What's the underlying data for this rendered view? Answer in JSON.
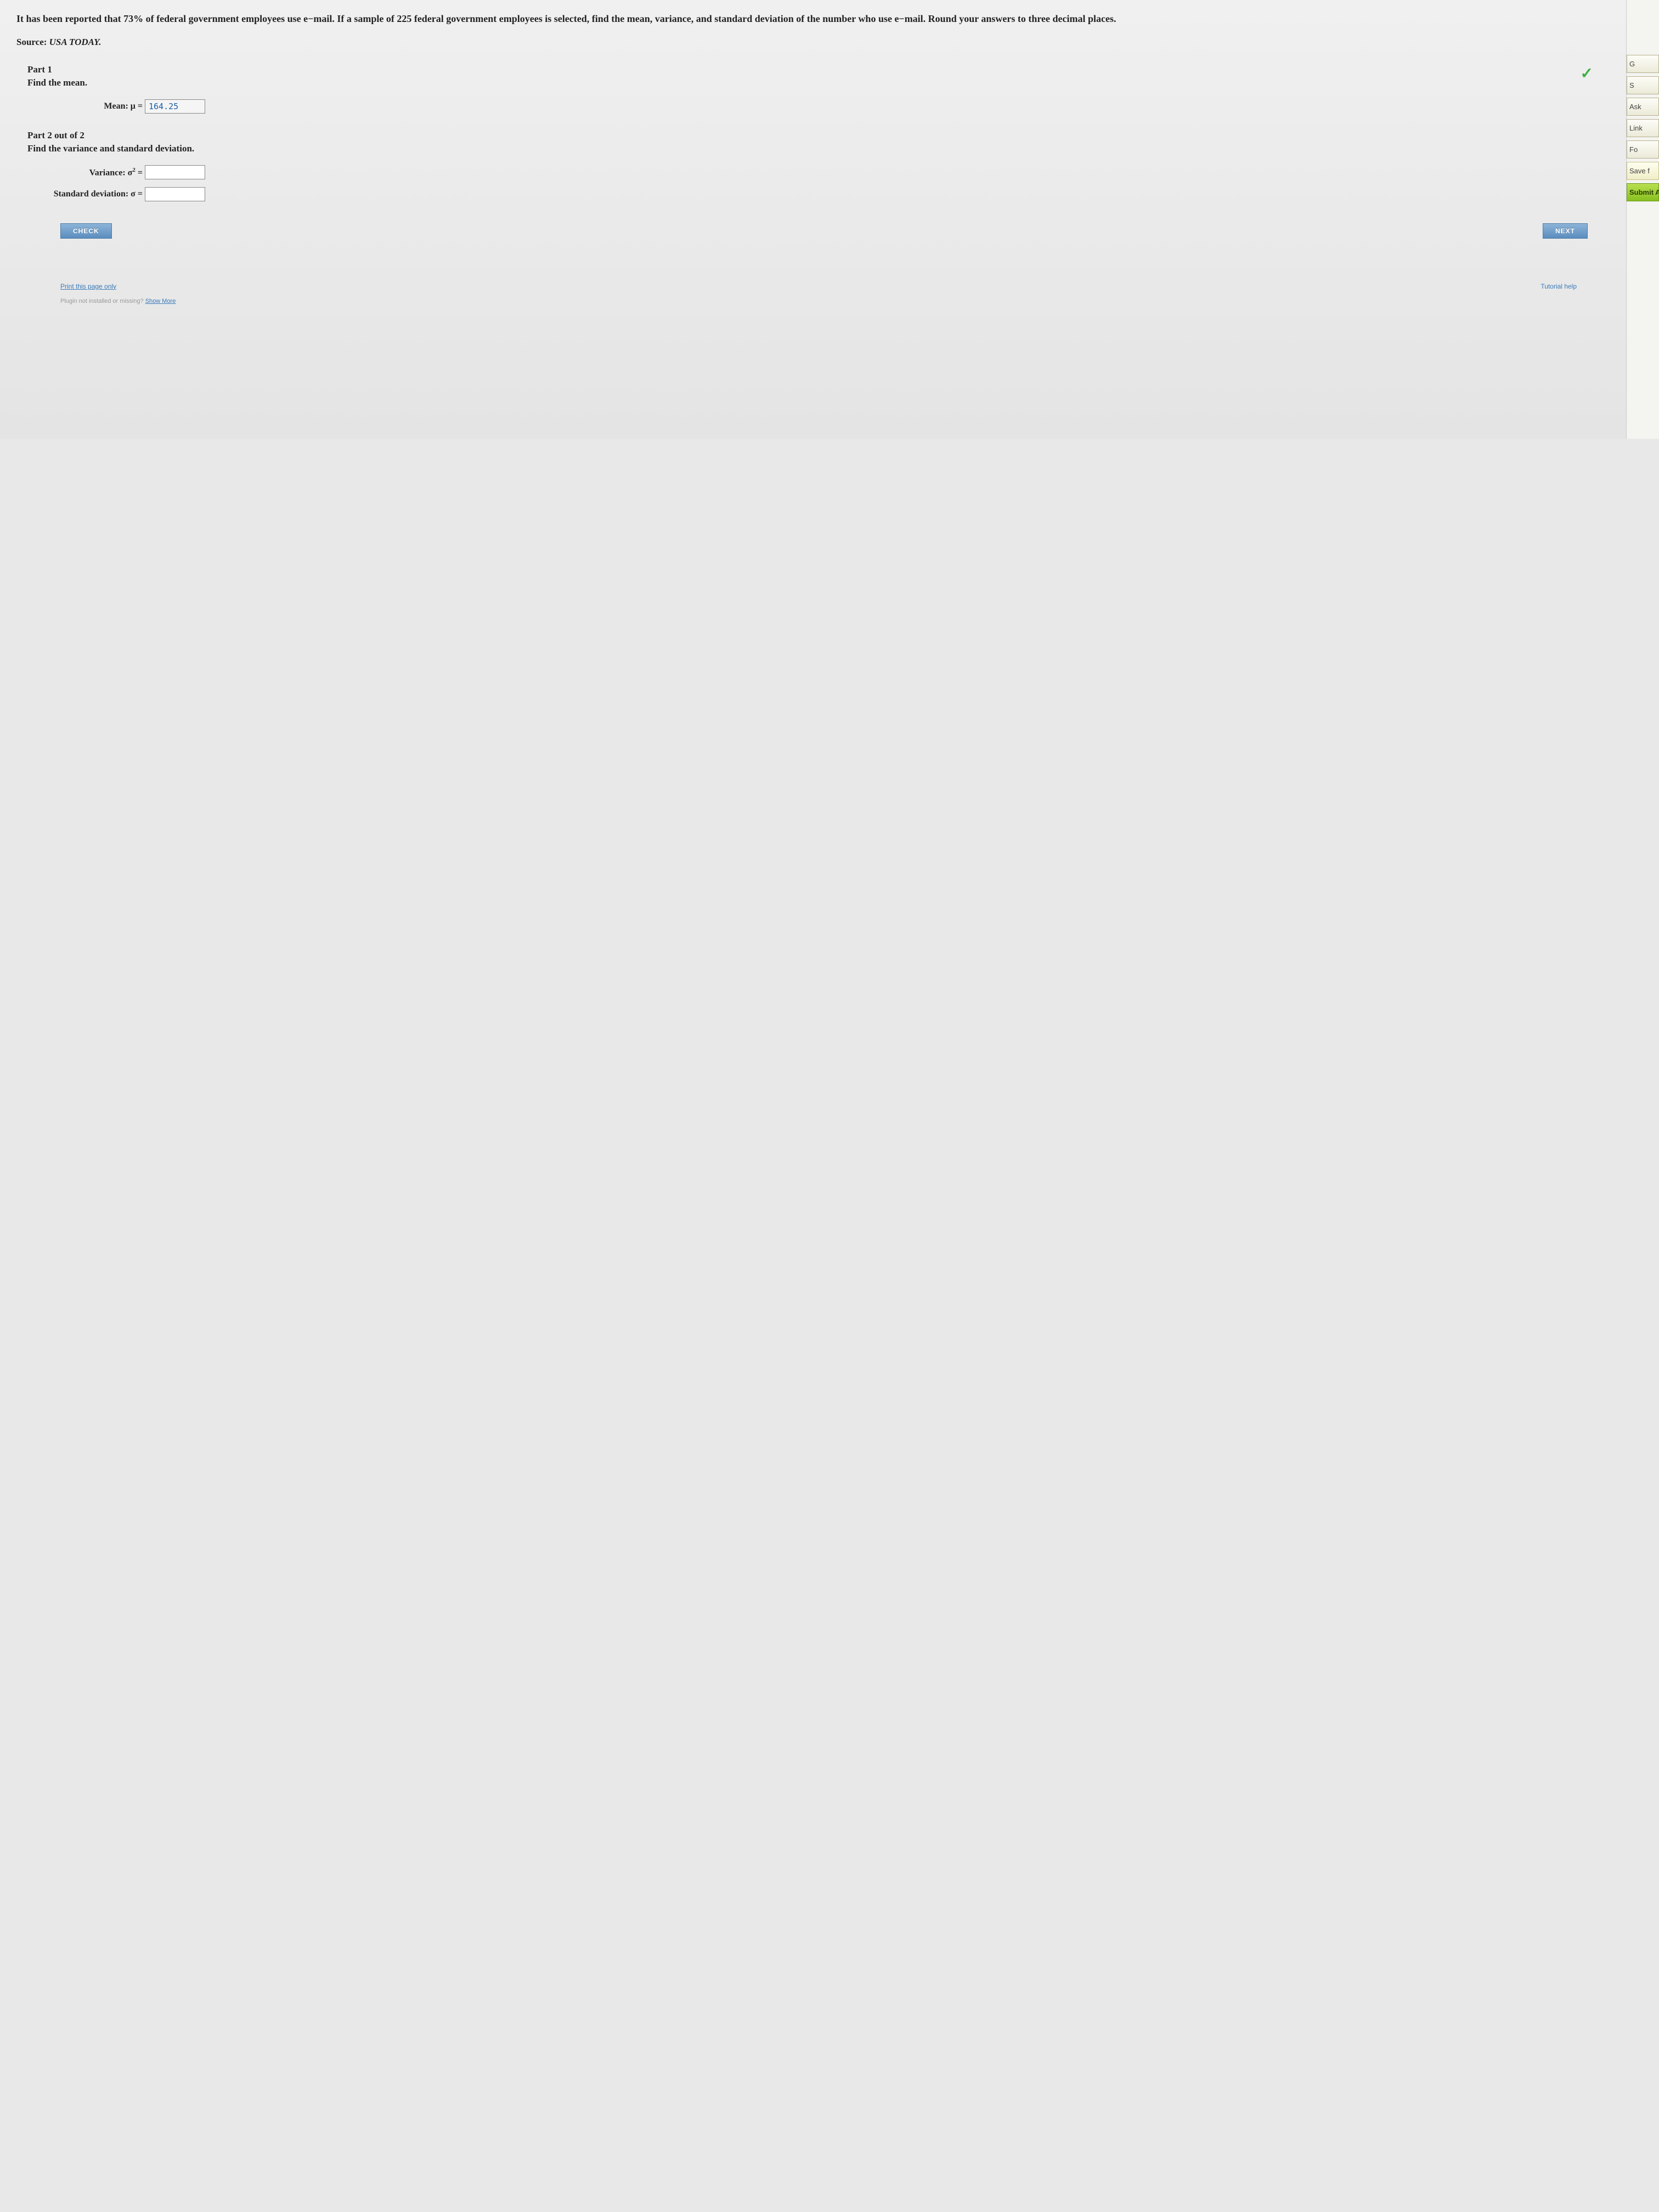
{
  "question": {
    "text": "It has been reported that 73% of federal government employees use e−mail. If a sample of 225 federal government employees is selected, find the mean, variance, and standard deviation of the number who use e−mail. Round your answers to three decimal places.",
    "source_label": "Source:",
    "source_name": "USA TODAY."
  },
  "part1": {
    "title": "Part 1",
    "instruction": "Find the mean.",
    "mean_label": "Mean: μ =",
    "mean_value": "164.25",
    "correct": true
  },
  "part2": {
    "title": "Part 2 out of 2",
    "instruction": "Find the variance and standard deviation.",
    "variance_label_prefix": "Variance: σ",
    "variance_label_suffix": " =",
    "variance_value": "",
    "stddev_label": "Standard deviation: σ =",
    "stddev_value": ""
  },
  "buttons": {
    "check": "CHECK",
    "next": "NEXT"
  },
  "footer": {
    "print_link": "Print this page only",
    "tutorial_link": "Tutorial help",
    "plugin_text": "Plugin not installed or missing? ",
    "show_more": "Show More"
  },
  "sidebar": {
    "g": "G",
    "s": "S",
    "ask": "Ask",
    "link": "Link",
    "fo": "Fo",
    "save": "Save f",
    "submit": "Submit As"
  }
}
